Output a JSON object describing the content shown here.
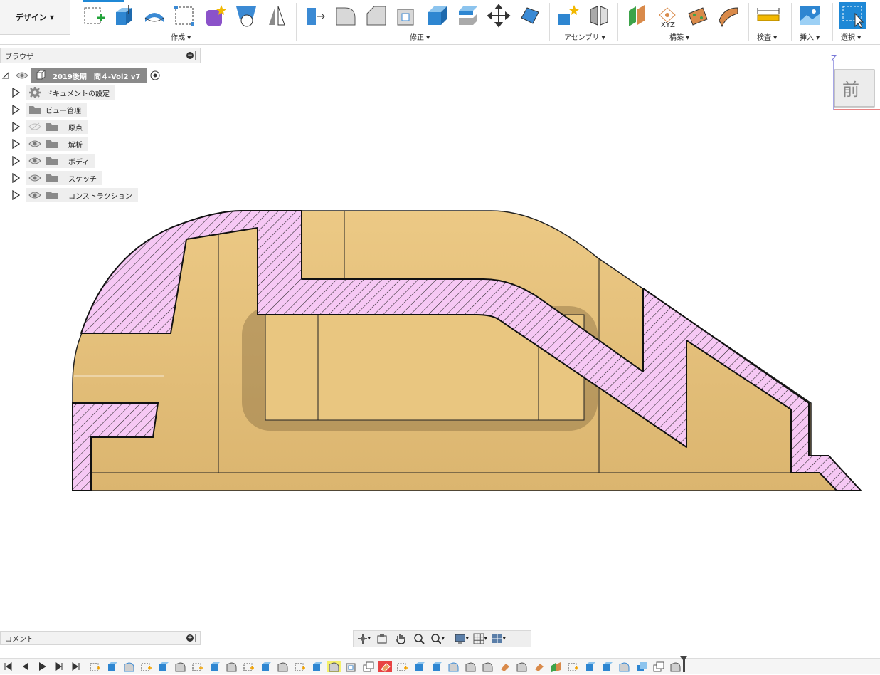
{
  "toolbar": {
    "design_label": "デザイン",
    "groups": {
      "create": "作成",
      "modify": "修正",
      "assemble": "アセンブリ",
      "construct": "構築",
      "inspect": "検査",
      "insert": "挿入",
      "select": "選択"
    },
    "xyz_text": "XYZ"
  },
  "browser": {
    "title": "ブラウザ",
    "root": "2019後期　問４-Vol2 v7",
    "items": [
      {
        "label": "ドキュメントの設定",
        "icon": "gear-icon"
      },
      {
        "label": "ビュー管理",
        "icon": "folder-icon"
      },
      {
        "label": "原点",
        "icon": "folder-icon",
        "visibility": "hidden"
      },
      {
        "label": "解析",
        "icon": "folder-icon",
        "visibility": "visible"
      },
      {
        "label": "ボディ",
        "icon": "folder-icon",
        "visibility": "visible"
      },
      {
        "label": "スケッチ",
        "icon": "folder-icon",
        "visibility": "visible"
      },
      {
        "label": "コンストラクション",
        "icon": "folder-icon",
        "visibility": "visible"
      }
    ]
  },
  "viewcube": {
    "face": "前",
    "axis": "Z"
  },
  "comments": {
    "title": "コメント"
  },
  "colors": {
    "body": "#e6c27c",
    "section_fill": "#f6c8f4",
    "accent": "#1e88d6",
    "timeline_highlight": "#f5f06a",
    "timeline_error": "#e84343"
  }
}
